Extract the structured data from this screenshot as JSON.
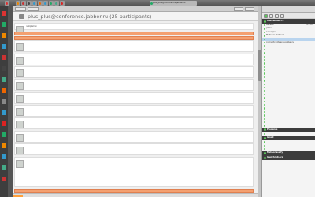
{
  "taskbar": {
    "tabs": [
      {
        "label": "",
        "color": "#d33"
      },
      {
        "label": "plus_plus@conference.jabber.ru",
        "color": "#2a6"
      },
      {
        "label": "",
        "color": "#e80"
      },
      {
        "label": "",
        "color": "#c33"
      },
      {
        "label": "",
        "color": "#444"
      },
      {
        "label": "",
        "color": "#39c"
      },
      {
        "label": "",
        "color": "#e60"
      },
      {
        "label": "",
        "color": "#39c"
      },
      {
        "label": "",
        "color": "#2a6"
      },
      {
        "label": "",
        "color": "#4a8"
      },
      {
        "label": "",
        "color": "#d22"
      }
    ]
  },
  "room": {
    "title": "plus_plus@conference.jabber.ru (25 participants)"
  },
  "messages": [
    {
      "nick": "",
      "text": "nakiplemon",
      "time": "",
      "highlight": false
    },
    {
      "nick": "",
      "text": "",
      "time": "",
      "highlight": true
    },
    {
      "nick": "",
      "text": "",
      "time": "",
      "highlight": true
    },
    {
      "nick": "",
      "text": "",
      "time": "",
      "highlight": false
    },
    {
      "nick": "",
      "text": "",
      "time": "",
      "highlight": false
    },
    {
      "nick": "",
      "text": "",
      "time": "",
      "highlight": false
    },
    {
      "nick": "",
      "text": "",
      "time": "",
      "highlight": false
    },
    {
      "nick": "",
      "text": "",
      "time": "",
      "highlight": false
    },
    {
      "nick": "",
      "text": "",
      "time": "",
      "highlight": false
    },
    {
      "nick": "",
      "text": "",
      "time": "",
      "highlight": false
    },
    {
      "nick": "",
      "text": "",
      "time": "",
      "highlight": false
    },
    {
      "nick": "",
      "text": "",
      "time": "",
      "highlight": false
    },
    {
      "nick": "",
      "text": "",
      "time": "",
      "highlight": false
    },
    {
      "nick": "",
      "text": "",
      "time": "",
      "highlight": true
    }
  ],
  "roster": {
    "groups": [
      {
        "name": "multiwifiled.ru",
        "items": [
          {
            "name": "General",
            "count": "103/103",
            "sel": false
          },
          {
            "name": "jabber",
            "count": "",
            "sel": false
          },
          {
            "name": "Launchpad",
            "count": "",
            "sel": false
          },
          {
            "name": "Multiuser chatroom",
            "count": "",
            "sel": false
          },
          {
            "name": "",
            "count": "",
            "sel": true
          },
          {
            "name": "coding@conference.jabber.ru",
            "count": "",
            "sel": false
          },
          {
            "name": "",
            "count": "",
            "sel": false
          },
          {
            "name": "",
            "count": "",
            "sel": false
          },
          {
            "name": "",
            "count": "",
            "sel": false
          },
          {
            "name": "",
            "count": "",
            "sel": false
          },
          {
            "name": "",
            "count": "",
            "sel": false
          },
          {
            "name": "",
            "count": "",
            "sel": false
          },
          {
            "name": "",
            "count": "",
            "sel": false
          },
          {
            "name": "",
            "count": "",
            "sel": false
          },
          {
            "name": "",
            "count": "",
            "sel": false
          },
          {
            "name": "",
            "count": "",
            "sel": false
          },
          {
            "name": "",
            "count": "",
            "sel": false
          },
          {
            "name": "",
            "count": "",
            "sel": false
          },
          {
            "name": "",
            "count": "",
            "sel": false
          },
          {
            "name": "",
            "count": "",
            "sel": false
          },
          {
            "name": "",
            "count": "",
            "sel": false
          },
          {
            "name": "",
            "count": "",
            "sel": false
          },
          {
            "name": "",
            "count": "",
            "sel": false
          },
          {
            "name": "",
            "count": "",
            "sel": false
          },
          {
            "name": "",
            "count": "",
            "sel": false
          },
          {
            "name": "",
            "count": "",
            "sel": false
          },
          {
            "name": "",
            "count": "",
            "sel": false
          },
          {
            "name": "",
            "count": "",
            "sel": false
          },
          {
            "name": "",
            "count": "",
            "sel": false
          },
          {
            "name": "",
            "count": "",
            "sel": false
          }
        ]
      },
      {
        "name": "Presence",
        "items": [
          {
            "name": "",
            "count": "",
            "sel": false
          }
        ]
      },
      {
        "name": "Gmail",
        "items": [
          {
            "name": "",
            "count": "",
            "sel": false
          },
          {
            "name": "",
            "count": "",
            "sel": false
          },
          {
            "name": "",
            "count": "",
            "sel": false
          }
        ]
      },
      {
        "name": "Meteoclassify",
        "items": []
      },
      {
        "name": "launchroll.org",
        "items": []
      }
    ]
  }
}
